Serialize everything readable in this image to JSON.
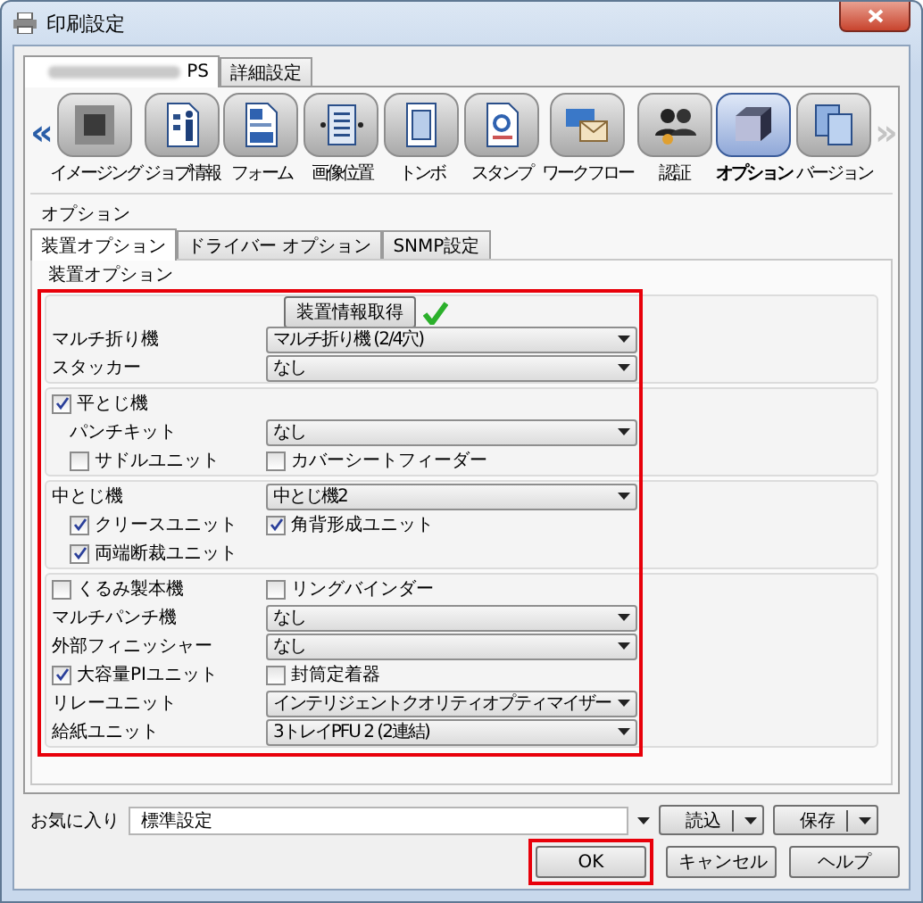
{
  "window": {
    "title": "印刷設定"
  },
  "tabs": [
    {
      "label": "PS",
      "selected": true
    },
    {
      "label": "詳細設定",
      "selected": false
    }
  ],
  "toolbar": {
    "prev": "«",
    "next": "»",
    "next_disabled": true,
    "items": [
      {
        "label": "イメージング",
        "selected": false
      },
      {
        "label": "ジョブ情報",
        "selected": false
      },
      {
        "label": "フォーム",
        "selected": false
      },
      {
        "label": "画像位置",
        "selected": false
      },
      {
        "label": "トンボ",
        "selected": false
      },
      {
        "label": "スタンプ",
        "selected": false
      },
      {
        "label": "ワークフロー",
        "selected": false
      },
      {
        "label": "認証",
        "selected": false
      },
      {
        "label": "オプション",
        "selected": true
      },
      {
        "label": "バージョン",
        "selected": false
      }
    ]
  },
  "options": {
    "title": "オプション",
    "tabs": [
      {
        "label": "装置オプション",
        "selected": true
      },
      {
        "label": "ドライバー オプション",
        "selected": false
      },
      {
        "label": "SNMP設定",
        "selected": false
      }
    ],
    "group_title": "装置オプション",
    "highlighted": true,
    "sections": [
      {
        "rows": [
          {
            "right": {
              "kind": "button",
              "label": "装置情報取得",
              "confirmed": true
            }
          },
          {
            "left": {
              "kind": "label",
              "text": "マルチ折り機"
            },
            "right": {
              "kind": "select",
              "value": "マルチ折り機 (2/4穴)"
            }
          },
          {
            "left": {
              "kind": "label",
              "text": "スタッカー"
            },
            "right": {
              "kind": "select",
              "value": "なし"
            }
          }
        ]
      },
      {
        "rows": [
          {
            "left": {
              "kind": "checkbox",
              "text": "平とじ機",
              "checked": true
            }
          }
        ],
        "children": [
          {
            "left": {
              "kind": "label",
              "text": "パンチキット"
            },
            "right": {
              "kind": "select",
              "value": "なし"
            }
          },
          {
            "left": {
              "kind": "checkbox",
              "text": "サドルユニット",
              "checked": false
            },
            "right": {
              "kind": "checkbox",
              "text": "カバーシートフィーダー",
              "checked": false
            }
          }
        ]
      },
      {
        "rows": [
          {
            "left": {
              "kind": "label",
              "text": "中とじ機"
            },
            "right": {
              "kind": "select",
              "value": "中とじ機2"
            }
          }
        ],
        "children": [
          {
            "left": {
              "kind": "checkbox",
              "text": "クリースユニット",
              "checked": true
            },
            "right": {
              "kind": "checkbox",
              "text": "角背形成ユニット",
              "checked": true
            }
          },
          {
            "left": {
              "kind": "checkbox",
              "text": "両端断裁ユニット",
              "checked": true
            }
          }
        ]
      },
      {
        "rows": [
          {
            "left": {
              "kind": "checkbox",
              "text": "くるみ製本機",
              "checked": false
            },
            "right": {
              "kind": "checkbox",
              "text": "リングバインダー",
              "checked": false
            }
          },
          {
            "left": {
              "kind": "label",
              "text": "マルチパンチ機"
            },
            "right": {
              "kind": "select",
              "value": "なし"
            }
          },
          {
            "left": {
              "kind": "label",
              "text": "外部フィニッシャー"
            },
            "right": {
              "kind": "select",
              "value": "なし"
            }
          },
          {
            "left": {
              "kind": "checkbox",
              "text": "大容量PIユニット",
              "checked": true
            },
            "right": {
              "kind": "checkbox",
              "text": "封筒定着器",
              "checked": false
            }
          },
          {
            "left": {
              "kind": "label",
              "text": "リレーユニット"
            },
            "right": {
              "kind": "select",
              "value": "インテリジェントクオリティオプティマイザー"
            }
          },
          {
            "left": {
              "kind": "label",
              "text": "給紙ユニット"
            },
            "right": {
              "kind": "select",
              "value": "3トレイPFU 2 (2連結)"
            }
          }
        ]
      }
    ]
  },
  "favorites": {
    "label": "お気に入り",
    "value": "標準設定",
    "buttons": [
      "読込",
      "保存"
    ]
  },
  "buttons": [
    {
      "label": "OK",
      "highlighted": true
    },
    {
      "label": "キャンセル",
      "highlighted": false
    },
    {
      "label": "ヘルプ",
      "highlighted": false
    }
  ]
}
